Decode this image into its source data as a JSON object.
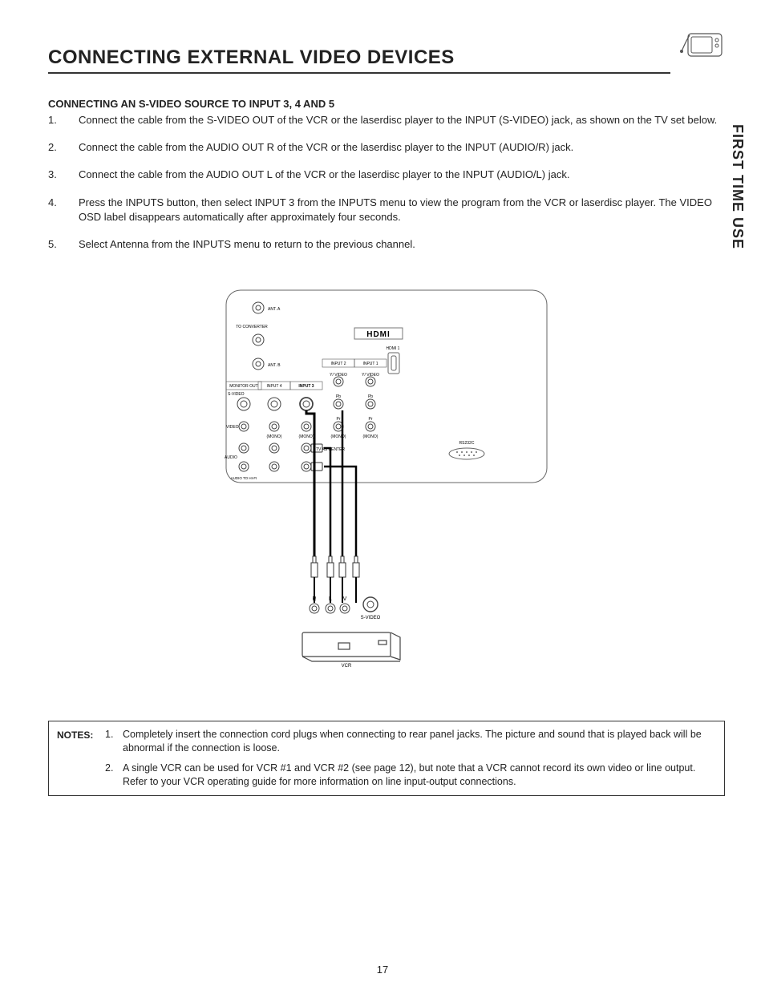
{
  "page": {
    "title": "CONNECTING EXTERNAL VIDEO DEVICES",
    "side_tab": "FIRST TIME USE",
    "page_number": "17"
  },
  "section": {
    "subhead": "CONNECTING AN S-VIDEO SOURCE TO INPUT 3, 4 AND 5",
    "steps": [
      "Connect the cable from the S-VIDEO OUT of the VCR or the laserdisc player to the INPUT (S-VIDEO) jack, as shown on the TV set below.",
      "Connect the cable from the AUDIO OUT R of the VCR or the laserdisc player to the INPUT (AUDIO/R) jack.",
      "Connect the cable from the AUDIO OUT L of the VCR or the laserdisc player to the INPUT (AUDIO/L) jack.",
      "Press the INPUTS button, then select INPUT 3 from the INPUTS menu to view the program from the VCR or laserdisc player. The VIDEO OSD label disappears automatically after approximately four seconds.",
      "Select Antenna from the INPUTS menu to return to the previous channel."
    ]
  },
  "diagram": {
    "labels": {
      "ant_a": "ANT. A",
      "to_converter": "TO CONVERTER",
      "ant_b": "ANT. B",
      "hdmi_logo": "HDMI",
      "hdmi1": "HDMI 1",
      "input1": "INPUT 1",
      "input2": "INPUT 2",
      "input3": "INPUT 3",
      "input4": "INPUT 4",
      "monitor_out": "MONITOR OUT",
      "svideo": "S-VIDEO",
      "y_video": "Y/ VIDEO",
      "pb": "Pb",
      "pr": "Pr",
      "mono": "(MONO)",
      "video": "VIDEO",
      "audio": "AUDIO",
      "tv_as_center": "TV AS CENTER",
      "rs232c": "RS232C",
      "audio_to_hifi": "AUDIO TO HI-FI",
      "r": "R",
      "l": "L",
      "v": "V",
      "svideo2": "S-VIDEO",
      "vcr": "VCR"
    }
  },
  "notes": {
    "label": "NOTES:",
    "items": [
      "Completely insert the connection cord plugs when connecting to rear panel jacks.  The picture and sound that is played back will be abnormal if the connection is loose.",
      "A single VCR can be used for VCR #1 and VCR #2 (see page 12), but note that a VCR cannot record its own video or line output.  Refer to your VCR operating guide for more information on line input-output connections."
    ]
  }
}
